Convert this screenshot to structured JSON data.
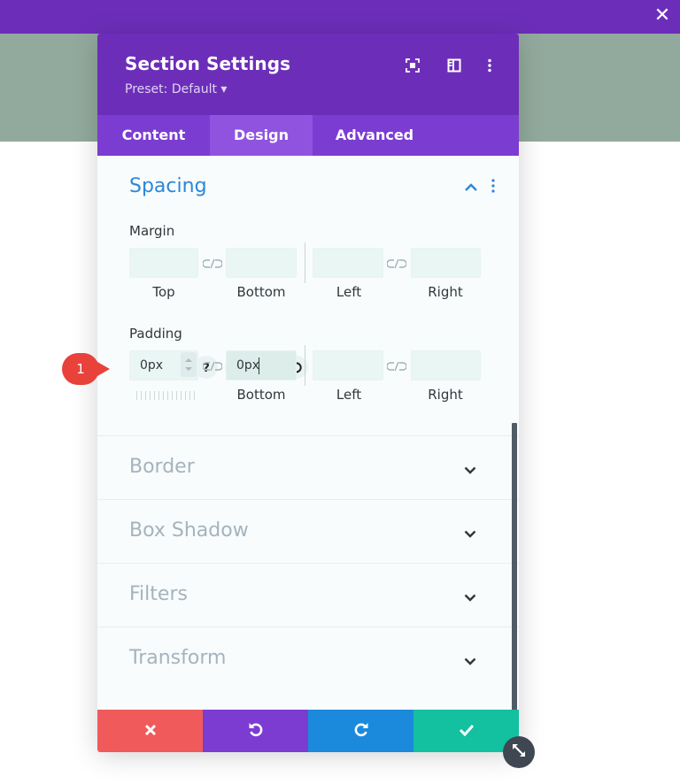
{
  "window": {
    "close_symbol": "✕"
  },
  "modal": {
    "title": "Section Settings",
    "preset_label": "Preset: Default ▾",
    "header_icons": [
      "fullscreen-icon",
      "sidebar-toggle-icon",
      "more-options-icon"
    ]
  },
  "tabs": [
    {
      "label": "Content",
      "active": false
    },
    {
      "label": "Design",
      "active": true
    },
    {
      "label": "Advanced",
      "active": false
    }
  ],
  "spacing": {
    "title": "Spacing",
    "margin": {
      "label": "Margin",
      "top_value": "",
      "bottom_value": "",
      "left_value": "",
      "right_value": "",
      "sub_labels": {
        "top": "Top",
        "bottom": "Bottom",
        "left": "Left",
        "right": "Right"
      }
    },
    "padding": {
      "label": "Padding",
      "top_value": "0px",
      "bottom_value": "0px",
      "left_value": "",
      "right_value": "",
      "sub_labels": {
        "bottom": "Bottom",
        "left": "Left",
        "right": "Right"
      },
      "tools": [
        "help-icon",
        "responsive-mobile-icon",
        "hover-pointer-icon",
        "reset-icon",
        "more-options-icon"
      ]
    }
  },
  "groups": [
    {
      "title": "Border"
    },
    {
      "title": "Box Shadow"
    },
    {
      "title": "Filters"
    },
    {
      "title": "Transform"
    }
  ],
  "footer": {
    "buttons": [
      {
        "name": "discard-button",
        "icon": "x-icon",
        "color": "#f05a5a"
      },
      {
        "name": "undo-button",
        "icon": "undo-icon",
        "color": "#7c3bd1"
      },
      {
        "name": "redo-button",
        "icon": "redo-icon",
        "color": "#1b89dc"
      },
      {
        "name": "save-button",
        "icon": "check-icon",
        "color": "#13c0a0"
      }
    ]
  },
  "annotation": {
    "number": "1",
    "color": "#e8423a"
  },
  "colors": {
    "header_purple": "#6c2eb9",
    "tab_bar_purple": "#7b3dd1",
    "active_tab": "#8f53e0",
    "section_title_blue": "#2b87da",
    "background_band": "#92aa9d"
  }
}
